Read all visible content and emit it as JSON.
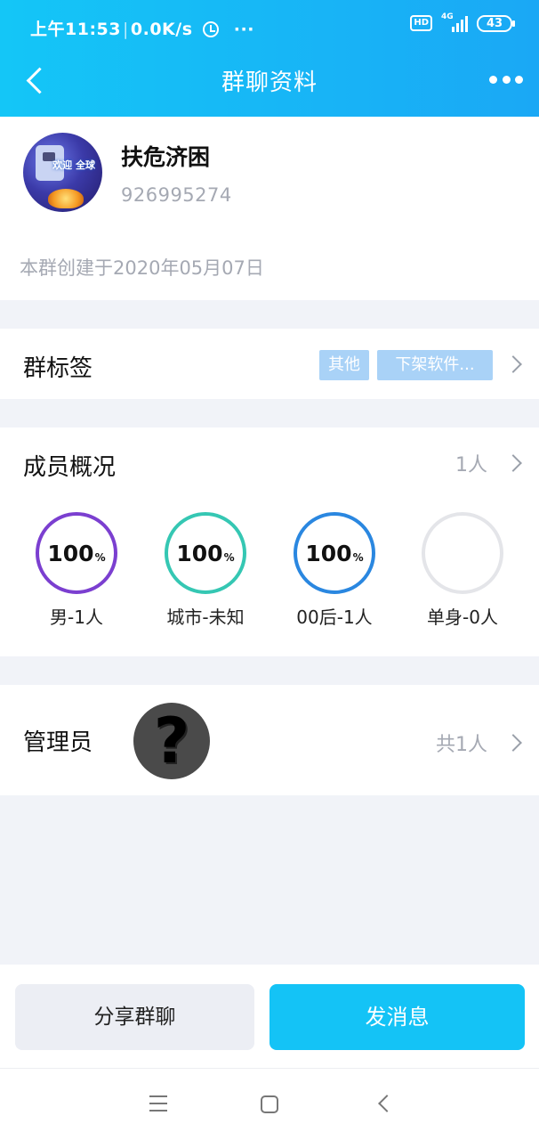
{
  "status_bar": {
    "time": "上午11:53",
    "speed": "0.0K/s",
    "dots": "···",
    "hd": "HD",
    "network": "4G",
    "battery": "43"
  },
  "header": {
    "title": "群聊资料"
  },
  "group": {
    "name": "扶危济困",
    "id": "926995274",
    "avatar_text": "欢迎 全球",
    "created": "本群创建于2020年05月07日"
  },
  "tags": {
    "label": "群标签",
    "items": [
      "其他",
      "下架软件..."
    ]
  },
  "members": {
    "label": "成员概况",
    "count": "1人",
    "stats": [
      {
        "value": "100",
        "unit": "%",
        "label": "男-1人",
        "color": "#7b3fd0"
      },
      {
        "value": "100",
        "unit": "%",
        "label": "城市-未知",
        "color": "#35c7b3"
      },
      {
        "value": "100",
        "unit": "%",
        "label": "00后-1人",
        "color": "#2a87e0"
      },
      {
        "value": "",
        "unit": "",
        "label": "单身-0人",
        "color": "#e4e5e9"
      }
    ]
  },
  "admins": {
    "label": "管理员",
    "count": "共1人",
    "avatar_glyph": "?"
  },
  "actions": {
    "share": "分享群聊",
    "send": "发消息"
  },
  "colors": {
    "accent": "#14c3f6",
    "tag_bg": "#a9d2f7"
  }
}
